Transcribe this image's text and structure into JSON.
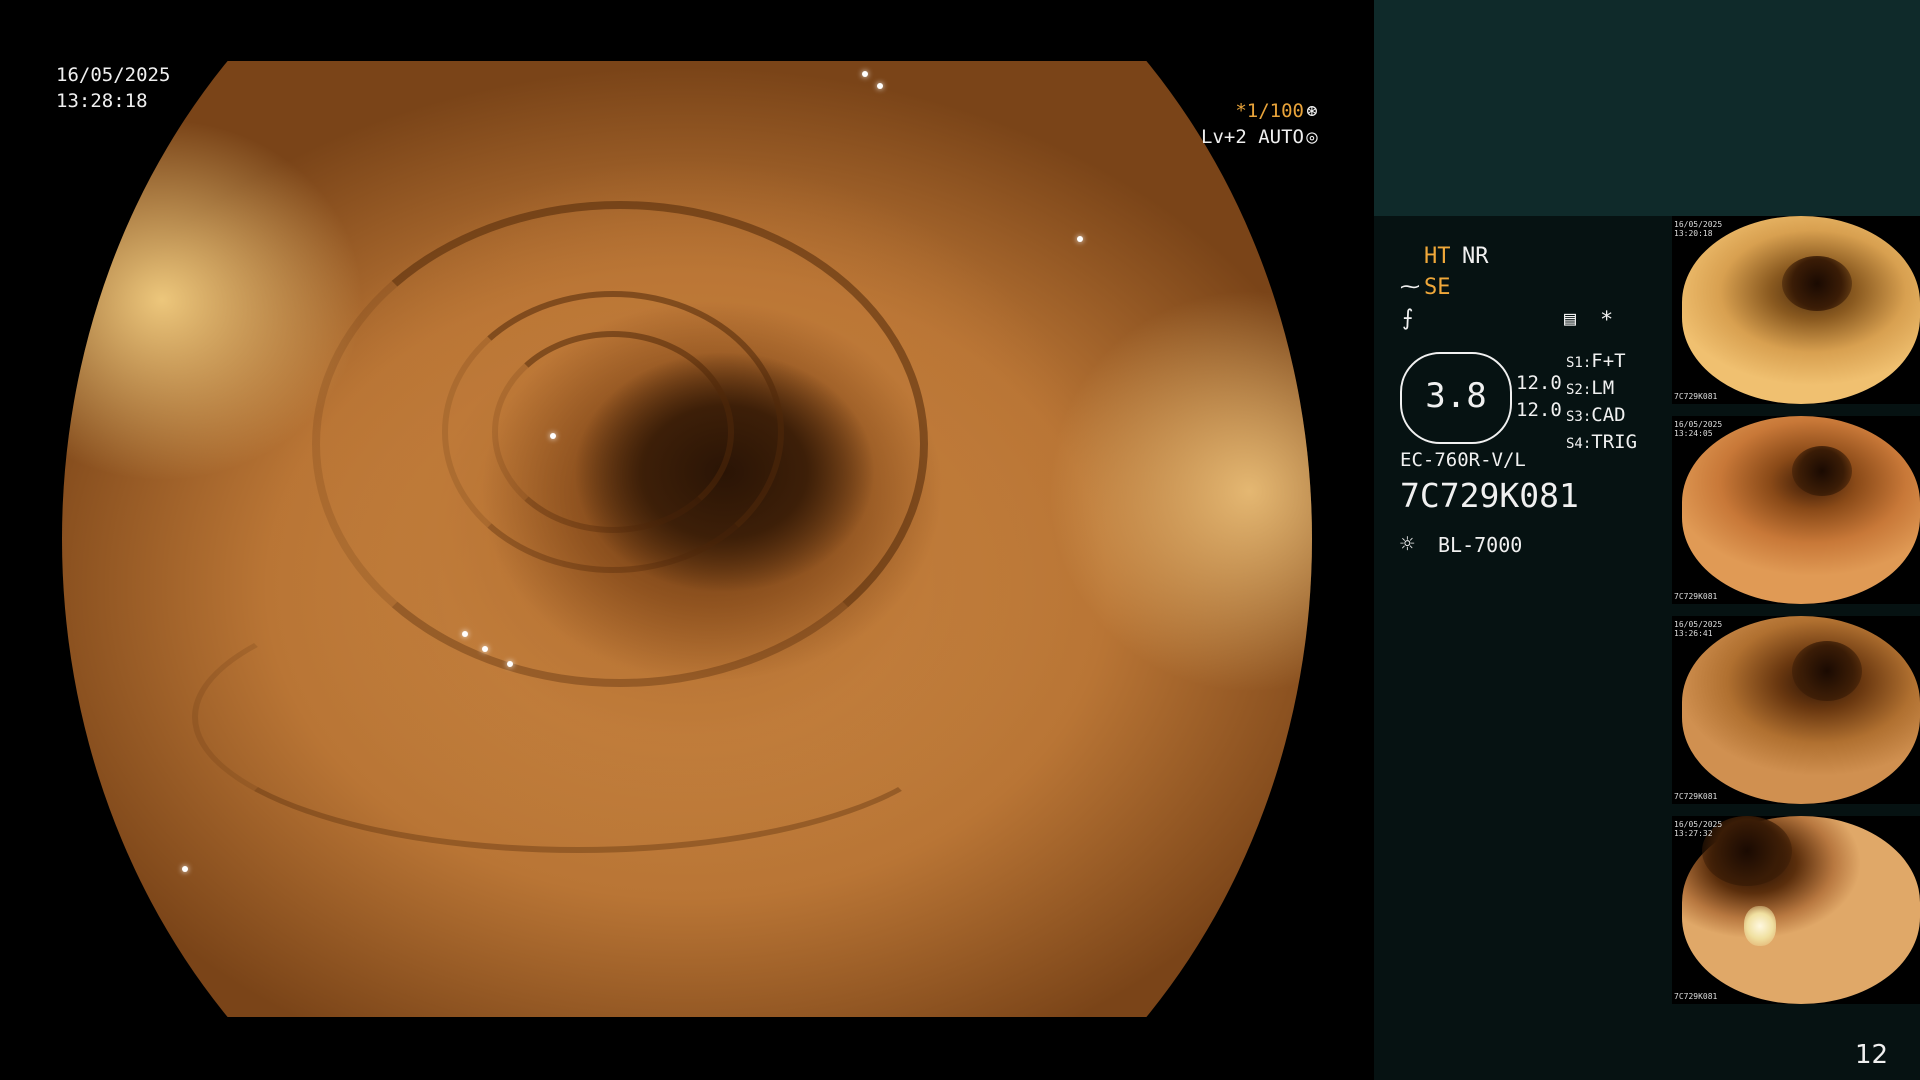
{
  "overlay": {
    "date": "16/05/2025",
    "time": "13:28:18",
    "shutter": "*1/100",
    "shutter_icon": "aperture-icon",
    "level": "Lv+2 AUTO",
    "level_icon": "iris-icon"
  },
  "panel": {
    "ht_label": "HT",
    "nr_label": "NR",
    "se_label": "SE",
    "se_icon": "structure-enhance-icon",
    "f_icon_char": "⨍",
    "menu_icon": "settings-panel-icon",
    "star": "*",
    "magnification": "3.8",
    "val1": "12.0",
    "val2": "12.0",
    "switches": [
      {
        "key": "S1",
        "value": "F+T"
      },
      {
        "key": "S2",
        "value": "LM"
      },
      {
        "key": "S3",
        "value": "CAD"
      },
      {
        "key": "S4",
        "value": "TRIG"
      }
    ],
    "scope_model": "EC-760R-V/L",
    "serial": "7C729K081",
    "light_source_icon": "light-source-icon",
    "light_source": "BL-7000",
    "page_number": "12"
  },
  "thumbnails": [
    {
      "date": "16/05/2025",
      "time": "13:20:18",
      "code": "7C729K081"
    },
    {
      "date": "16/05/2025",
      "time": "13:24:05",
      "code": "7C729K081"
    },
    {
      "date": "16/05/2025",
      "time": "13:26:41",
      "code": "7C729K081"
    },
    {
      "date": "16/05/2025",
      "time": "13:27:32",
      "code": "7C729K081"
    }
  ]
}
